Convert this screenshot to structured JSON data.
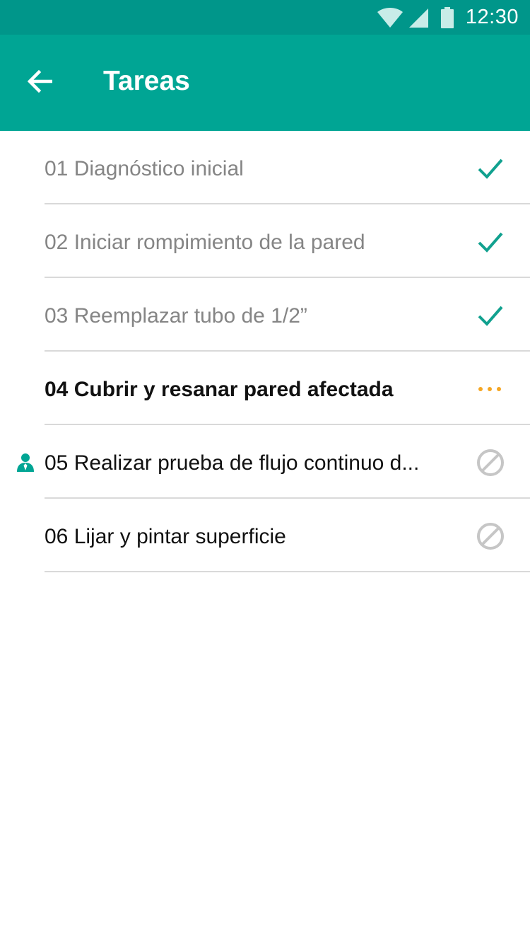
{
  "status_bar": {
    "time": "12:30",
    "wifi_icon": "wifi-icon",
    "signal_icon": "cell-signal-icon",
    "battery_icon": "battery-icon"
  },
  "app_bar": {
    "title": "Tareas",
    "back_icon": "arrow-back-icon"
  },
  "colors": {
    "status_bar": "#00968a",
    "app_bar": "#00a594",
    "done_check": "#11a18f",
    "in_progress": "#f5a623",
    "blocked": "#c6c6c6",
    "assignee": "#00a594"
  },
  "tasks": [
    {
      "label": "01 Diagnóstico inicial",
      "state": "done",
      "status_icon": "check-icon"
    },
    {
      "label": "02 Iniciar rompimiento de la pared",
      "state": "done",
      "status_icon": "check-icon"
    },
    {
      "label": "03 Reemplazar tubo de 1/2”",
      "state": "done",
      "status_icon": "check-icon"
    },
    {
      "label": "04 Cubrir y resanar pared afectada",
      "state": "in-progress",
      "status_icon": "more-dots-icon"
    },
    {
      "label": "05 Realizar prueba de flujo continuo d...",
      "state": "blocked",
      "status_icon": "blocked-icon",
      "assignee_icon": "person-icon"
    },
    {
      "label": "06 Lijar y pintar superficie",
      "state": "blocked",
      "status_icon": "blocked-icon"
    }
  ]
}
